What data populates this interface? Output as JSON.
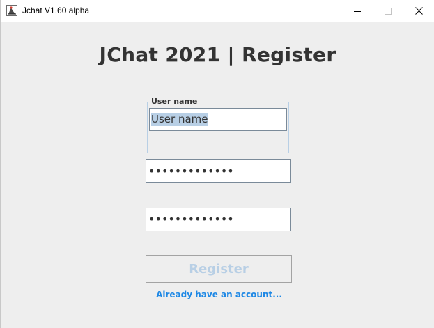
{
  "window": {
    "title": "Jchat V1.60 alpha",
    "icon": "java-duke-icon",
    "controls": {
      "minimize": "minimize-icon",
      "maximize": "maximize-icon",
      "close": "close-icon"
    }
  },
  "heading": "JChat 2021 | Register",
  "form": {
    "username": {
      "legend": "User name",
      "value": "User name"
    },
    "password": {
      "value": "•••••••••••••"
    },
    "confirm_password": {
      "value": "•••••••••••••"
    },
    "register_label": "Register",
    "login_link": "Already have an account..."
  },
  "colors": {
    "background": "#eeeeee",
    "heading": "#333333",
    "selection": "#b8cfe5",
    "disabled_text": "#b8cfe5",
    "link": "#1e88e5"
  }
}
